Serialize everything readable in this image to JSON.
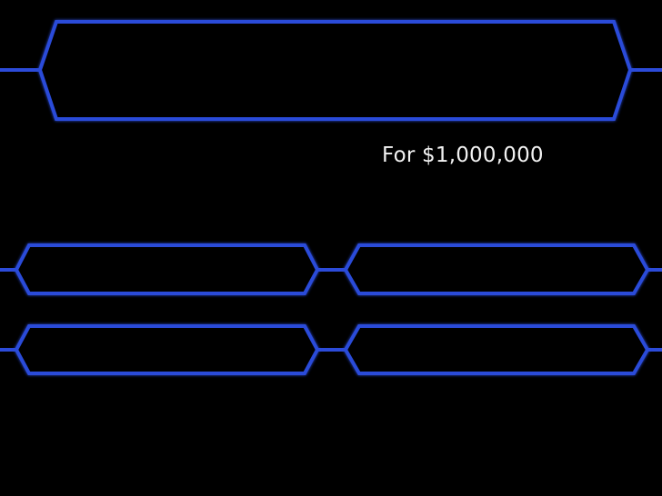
{
  "prize": {
    "label": "For $1,000,000"
  },
  "question": {
    "text": ""
  },
  "answers": [
    {
      "id": "a",
      "text": ""
    },
    {
      "id": "b",
      "text": ""
    },
    {
      "id": "c",
      "text": ""
    },
    {
      "id": "d",
      "text": ""
    }
  ],
  "colors": {
    "background": "#000000",
    "panel_border": "#2c4bd9",
    "panel_glow": "#1a2fa0",
    "connector": "#2c4bd9",
    "text": "#f2f2f2"
  }
}
